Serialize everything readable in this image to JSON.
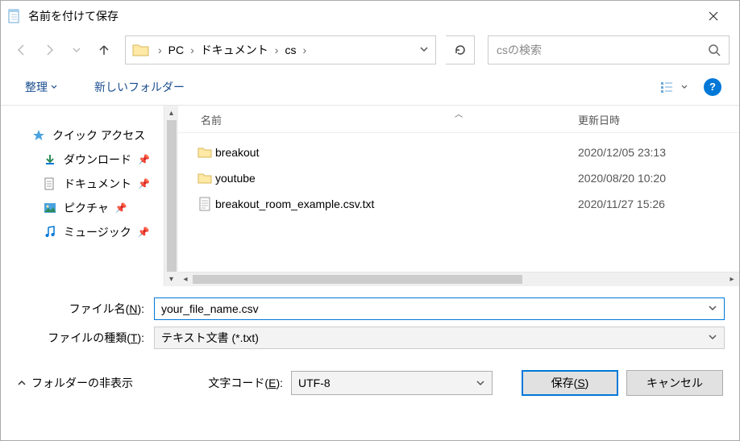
{
  "title": "名前を付けて保存",
  "breadcrumb": {
    "pc": "PC",
    "docs": "ドキュメント",
    "cur": "cs"
  },
  "search_placeholder": "csの検索",
  "toolbar": {
    "organize": "整理",
    "newfolder": "新しいフォルダー"
  },
  "sidebar": {
    "quick": "クイック アクセス",
    "downloads": "ダウンロード",
    "documents": "ドキュメント",
    "pictures": "ピクチャ",
    "music": "ミュージック"
  },
  "columns": {
    "name": "名前",
    "date": "更新日時"
  },
  "files": [
    {
      "name": "breakout",
      "date": "2020/12/05 23:13",
      "type": "folder"
    },
    {
      "name": "youtube",
      "date": "2020/08/20 10:20",
      "type": "folder"
    },
    {
      "name": "breakout_room_example.csv.txt",
      "date": "2020/11/27 15:26",
      "type": "file"
    }
  ],
  "labels": {
    "filename": "ファイル名(",
    "filename_k": "N",
    "filename_e": "):",
    "filetype": "ファイルの種類(",
    "filetype_k": "T",
    "filetype_e": "):",
    "encoding": "文字コード(",
    "encoding_k": "E",
    "encoding_e": "):",
    "hide": "フォルダーの非表示",
    "save": "保存(",
    "save_k": "S",
    "save_e": ")",
    "cancel": "キャンセル"
  },
  "values": {
    "filename": "your_file_name.csv",
    "filetype": "テキスト文書 (*.txt)",
    "encoding": "UTF-8"
  }
}
